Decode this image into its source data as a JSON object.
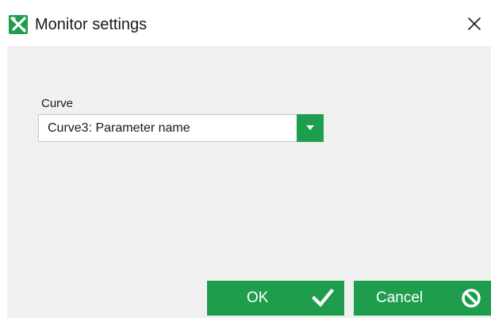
{
  "window": {
    "title": "Monitor settings",
    "app_icon": "tools-icon",
    "close_icon": "close-icon"
  },
  "form": {
    "curve_label": "Curve",
    "curve_selected": "Curve3: Parameter name"
  },
  "buttons": {
    "ok_label": "OK",
    "ok_icon": "checkmark-icon",
    "cancel_label": "Cancel",
    "cancel_icon": "prohibited-icon"
  },
  "colors": {
    "accent": "#1e9e4c",
    "panel_background": "#f0f0f0"
  }
}
